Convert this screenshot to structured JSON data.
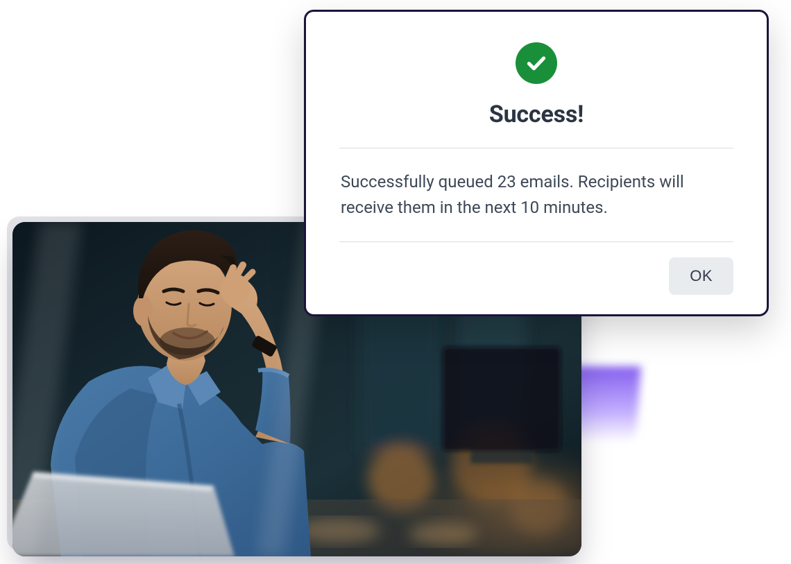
{
  "dialog": {
    "icon": "check-circle",
    "title": "Success!",
    "message": "Successfully queued 23 emails. Recipients will receive them in the next 10 minutes.",
    "ok_label": "OK",
    "accent_color": "#1a8f3a"
  },
  "background_image": {
    "description": "man-on-phone-office-photo"
  }
}
